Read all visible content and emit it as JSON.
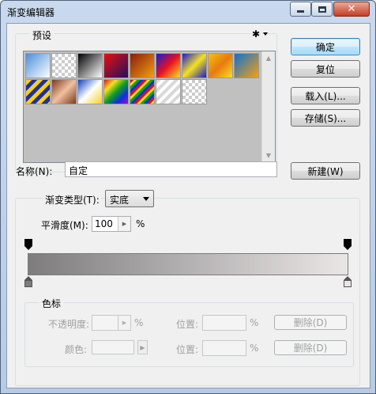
{
  "window": {
    "title": "渐变编辑器"
  },
  "caption": {
    "close_glyph": "✕"
  },
  "presets": {
    "group_label": "预设",
    "gear_glyph": "✱",
    "swatches": [
      "linear-gradient(135deg,#4a90d9,#ffffff)",
      "repeating-conic-gradient(#ccc 0 25%,#fff 0 50%) 0 0/8px 8px",
      "linear-gradient(135deg,#000000,#ffffff)",
      "linear-gradient(135deg,#e81010,#201060)",
      "linear-gradient(135deg,#8b1c0c,#f2a010)",
      "linear-gradient(135deg,#1a1ad0,#e81020,#f5e020)",
      "linear-gradient(135deg,#1a1ad0,#f5e020,#1a1ad0)",
      "linear-gradient(135deg,#f5c010,#e87a10,#f5e020)",
      "linear-gradient(135deg,#1070d0,#f5a010)",
      "repeating-linear-gradient(135deg,#f5d020 0 5px,#2030a0 5px 10px)",
      "linear-gradient(135deg,#7a3a20,#f0c0a0,#7a3a20)",
      "linear-gradient(135deg,#1040c0,#ffffff,#f5d020)",
      "linear-gradient(135deg,#e01010,#f5e020,#10a020,#1030e0,#a010c0)",
      "repeating-linear-gradient(135deg,#e01010 0 3px,#f5e020 3px 6px,#10a020 6px 9px,#1030e0 9px 12px)",
      "repeating-linear-gradient(135deg,#d8d8d8 0 4px,#ffffff 4px 8px)",
      "repeating-conic-gradient(#ccc 0 25%,#fff 0 50%) 0 0/8px 8px"
    ]
  },
  "buttons": {
    "ok": "确定",
    "reset": "复位",
    "load": "载入(L)...",
    "save": "存储(S)...",
    "new": "新建(W)"
  },
  "name": {
    "label": "名称(N):",
    "value": "自定"
  },
  "gradient_type": {
    "label": "渐变类型(T):",
    "selected": "实底",
    "smoothness_label": "平滑度(M):",
    "smoothness_value": "100",
    "smoothness_unit": "%"
  },
  "gradient": {
    "from": "#7e7c7d",
    "to": "#eae6e6"
  },
  "color_stops": {
    "group_label": "色标",
    "opacity_label": "不透明度:",
    "opacity_unit": "%",
    "opacity_location_label": "位置:",
    "opacity_location_unit": "%",
    "opacity_delete": "删除(D)",
    "color_label": "颜色:",
    "color_location_label": "位置:",
    "color_location_unit": "%",
    "color_delete": "删除(D)"
  }
}
